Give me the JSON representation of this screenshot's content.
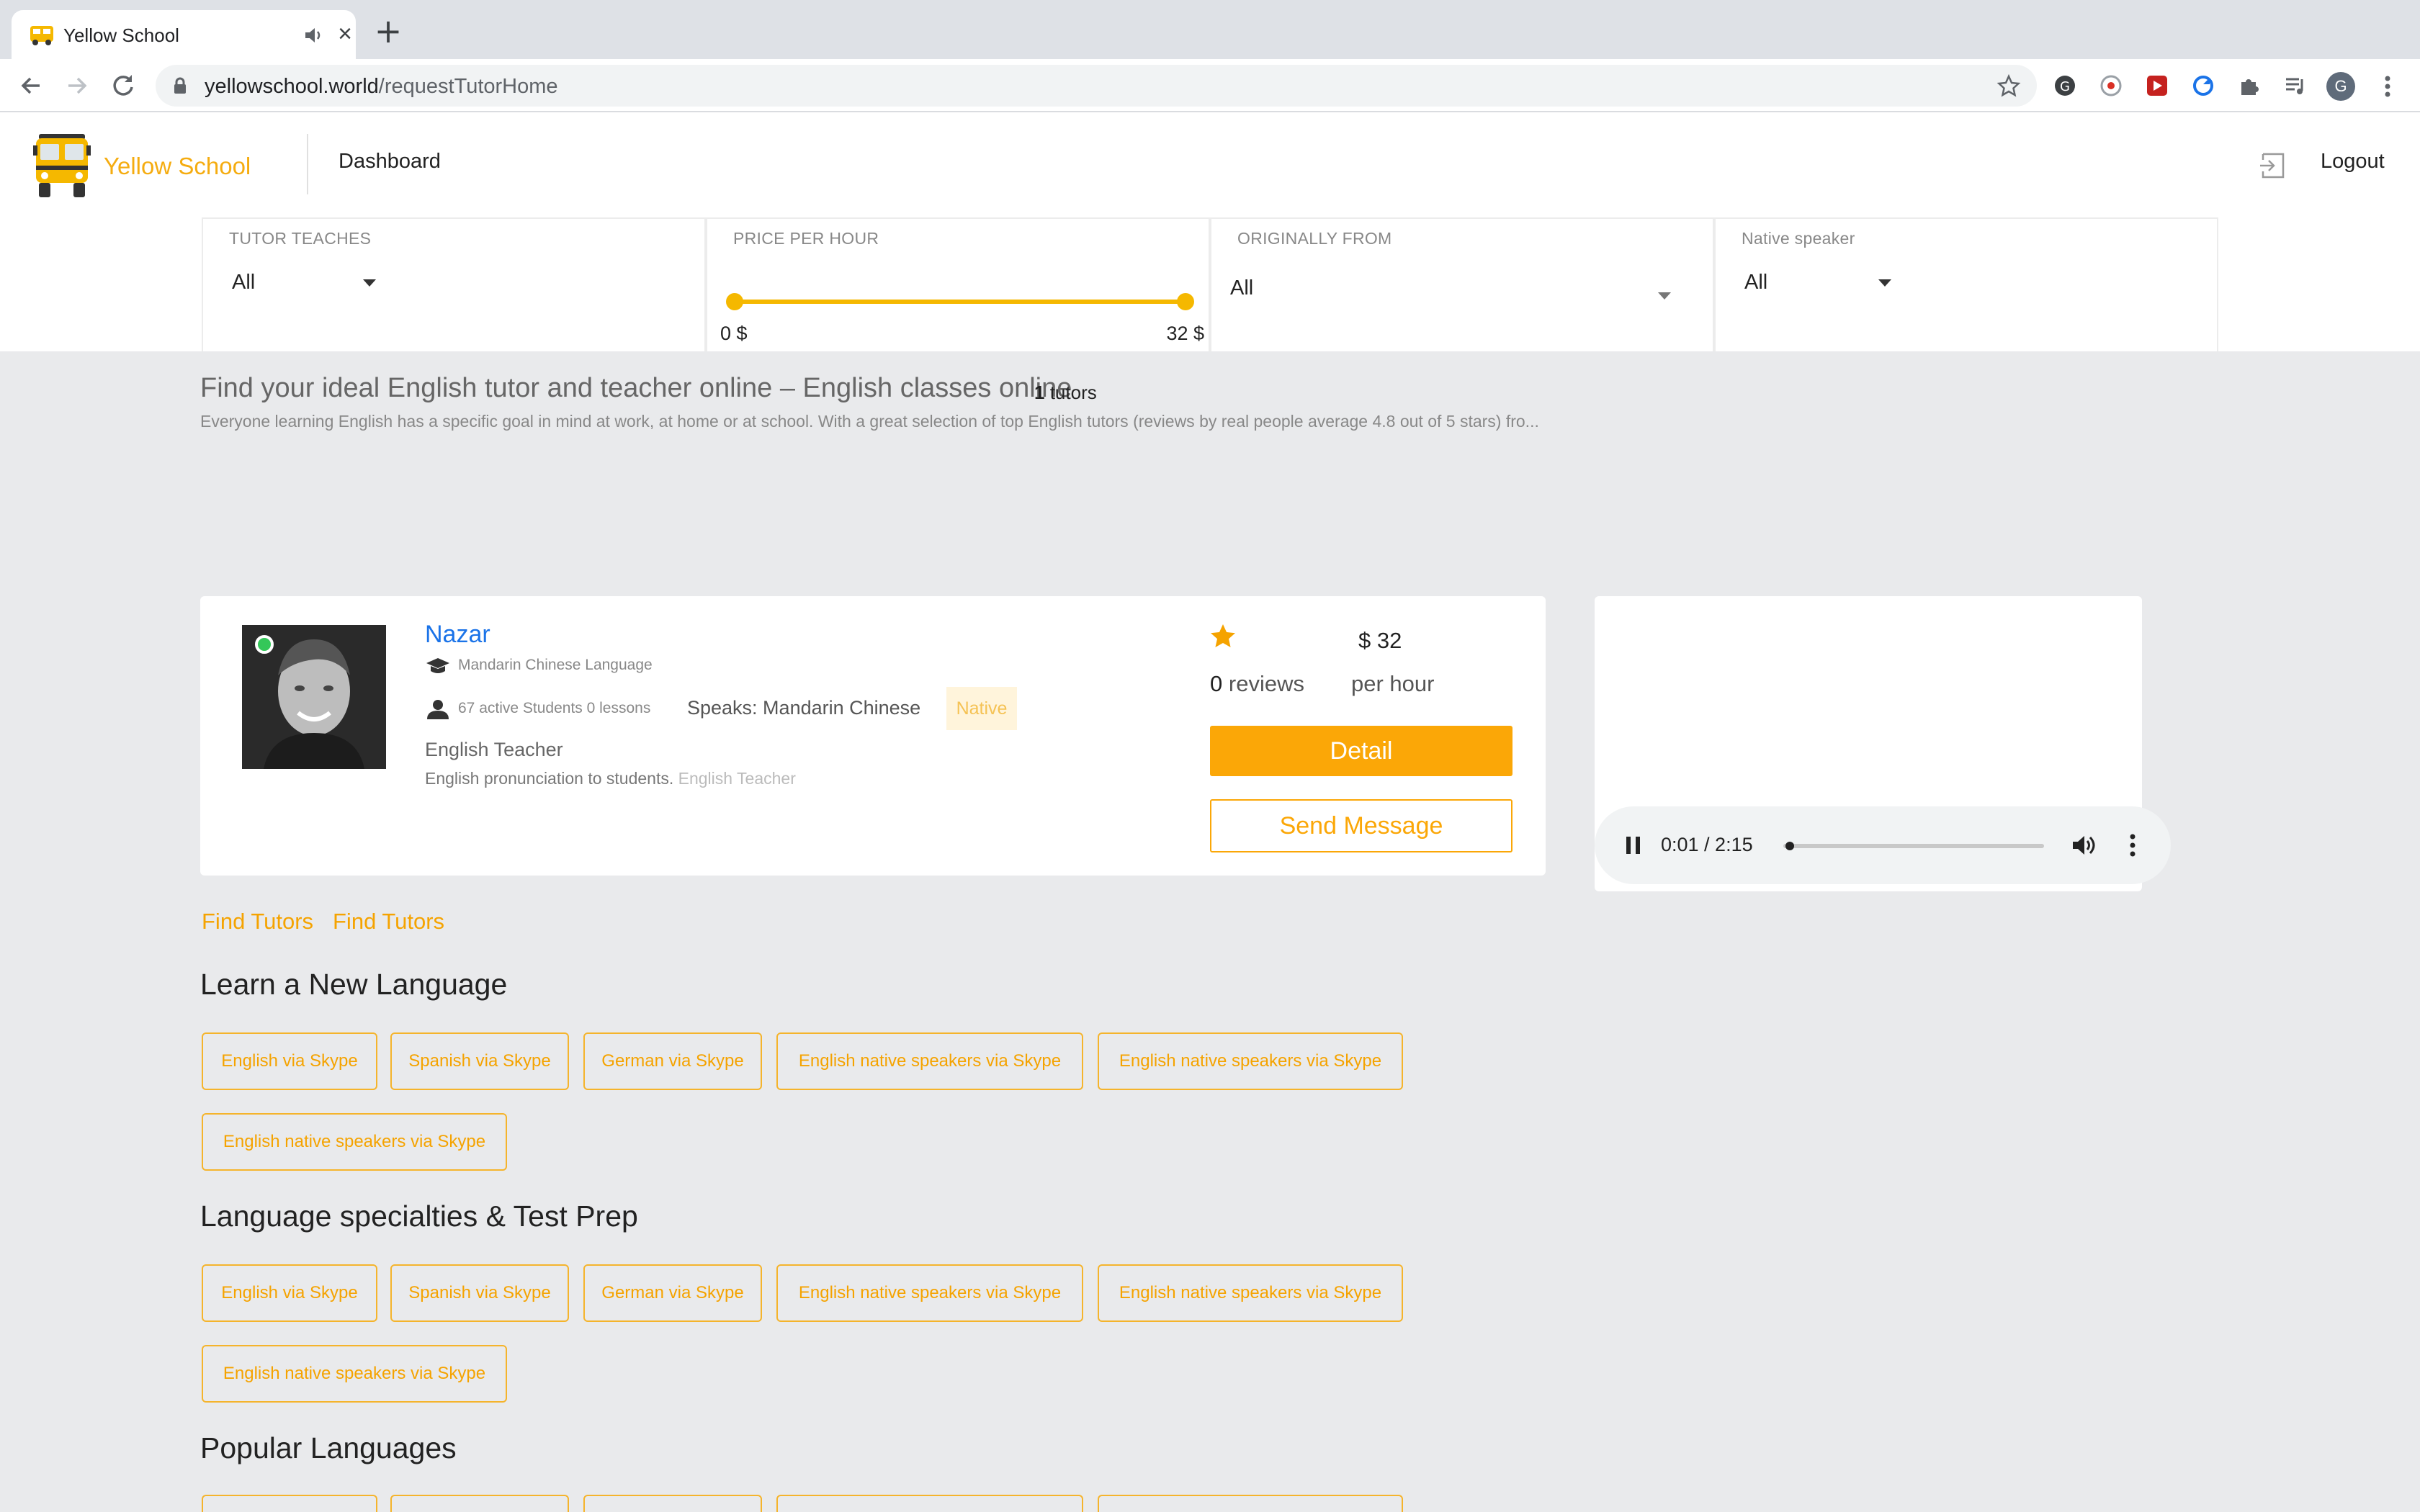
{
  "browser": {
    "tab_title": "Yellow School",
    "url_host": "yellowschool.world",
    "url_path": "/requestTutorHome",
    "profile_initial": "G"
  },
  "header": {
    "brand": "Yellow School",
    "nav_dashboard": "Dashboard",
    "logout": "Logout"
  },
  "filters": {
    "tutor_teaches": {
      "label": "TUTOR TEACHES",
      "value": "All"
    },
    "price": {
      "label": "PRICE PER HOUR",
      "min_label": "0 $",
      "max_label": "32 $",
      "min": 0,
      "max": 32
    },
    "originally_from": {
      "label": "ORIGINALLY FROM",
      "value": "All"
    },
    "native_speaker": {
      "label": "Native speaker",
      "value": "All"
    }
  },
  "intro": {
    "title": "Find your ideal English tutor and teacher online – English classes online",
    "count_number": "1",
    "count_label": "tutors",
    "text": "Everyone learning English has a specific goal in mind at work, at home or at school. With a great selection of top English tutors (reviews by real people average 4.8 out of 5 stars) fro..."
  },
  "tutor": {
    "name": "Nazar",
    "subject": "Mandarin Chinese Language",
    "students": "67 active Students 0 lessons",
    "speaks": "Speaks: Mandarin Chinese",
    "native_badge": "Native",
    "role": "English Teacher",
    "description": "English pronunciation to students.",
    "description_tag": "English Teacher",
    "price": "$ 32",
    "per_hour": "per hour",
    "reviews_count": "0",
    "reviews_label": "reviews",
    "detail_button": "Detail",
    "message_button": "Send Message"
  },
  "audio": {
    "time": "0:01 / 2:15",
    "progress": 0.0074
  },
  "links": {
    "find_tutors_1": "Find Tutors",
    "find_tutors_2": "Find Tutors"
  },
  "sections": [
    {
      "title": "Learn a New Language",
      "chips": [
        "English via Skype",
        "Spanish via Skype",
        "German via Skype",
        "English native speakers via Skype",
        "English native speakers via Skype",
        "English native speakers via Skype"
      ]
    },
    {
      "title": "Language specialties & Test Prep",
      "chips": [
        "English via Skype",
        "Spanish via Skype",
        "German via Skype",
        "English native speakers via Skype",
        "English native speakers via Skype",
        "English native speakers via Skype"
      ]
    },
    {
      "title": "Popular Languages",
      "chips": []
    }
  ],
  "colors": {
    "brand": "#f5ac10",
    "accent_button": "#fba707",
    "link_blue": "#1a73e8",
    "online": "#34c759"
  }
}
